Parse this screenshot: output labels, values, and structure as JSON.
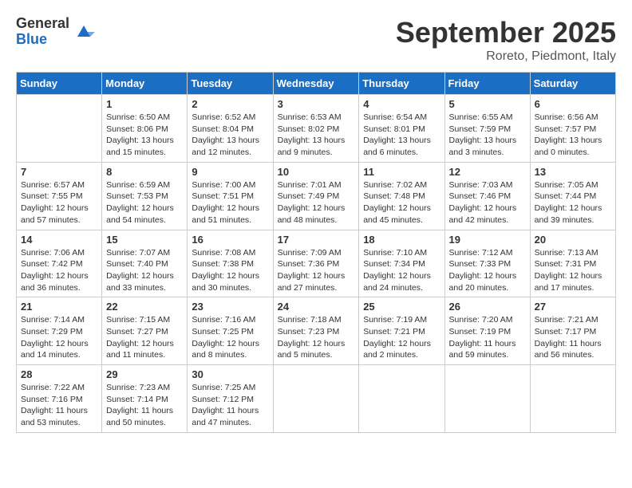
{
  "header": {
    "logo_general": "General",
    "logo_blue": "Blue",
    "title": "September 2025",
    "location": "Roreto, Piedmont, Italy"
  },
  "days_of_week": [
    "Sunday",
    "Monday",
    "Tuesday",
    "Wednesday",
    "Thursday",
    "Friday",
    "Saturday"
  ],
  "weeks": [
    [
      {
        "day": "",
        "info": ""
      },
      {
        "day": "1",
        "info": "Sunrise: 6:50 AM\nSunset: 8:06 PM\nDaylight: 13 hours\nand 15 minutes."
      },
      {
        "day": "2",
        "info": "Sunrise: 6:52 AM\nSunset: 8:04 PM\nDaylight: 13 hours\nand 12 minutes."
      },
      {
        "day": "3",
        "info": "Sunrise: 6:53 AM\nSunset: 8:02 PM\nDaylight: 13 hours\nand 9 minutes."
      },
      {
        "day": "4",
        "info": "Sunrise: 6:54 AM\nSunset: 8:01 PM\nDaylight: 13 hours\nand 6 minutes."
      },
      {
        "day": "5",
        "info": "Sunrise: 6:55 AM\nSunset: 7:59 PM\nDaylight: 13 hours\nand 3 minutes."
      },
      {
        "day": "6",
        "info": "Sunrise: 6:56 AM\nSunset: 7:57 PM\nDaylight: 13 hours\nand 0 minutes."
      }
    ],
    [
      {
        "day": "7",
        "info": "Sunrise: 6:57 AM\nSunset: 7:55 PM\nDaylight: 12 hours\nand 57 minutes."
      },
      {
        "day": "8",
        "info": "Sunrise: 6:59 AM\nSunset: 7:53 PM\nDaylight: 12 hours\nand 54 minutes."
      },
      {
        "day": "9",
        "info": "Sunrise: 7:00 AM\nSunset: 7:51 PM\nDaylight: 12 hours\nand 51 minutes."
      },
      {
        "day": "10",
        "info": "Sunrise: 7:01 AM\nSunset: 7:49 PM\nDaylight: 12 hours\nand 48 minutes."
      },
      {
        "day": "11",
        "info": "Sunrise: 7:02 AM\nSunset: 7:48 PM\nDaylight: 12 hours\nand 45 minutes."
      },
      {
        "day": "12",
        "info": "Sunrise: 7:03 AM\nSunset: 7:46 PM\nDaylight: 12 hours\nand 42 minutes."
      },
      {
        "day": "13",
        "info": "Sunrise: 7:05 AM\nSunset: 7:44 PM\nDaylight: 12 hours\nand 39 minutes."
      }
    ],
    [
      {
        "day": "14",
        "info": "Sunrise: 7:06 AM\nSunset: 7:42 PM\nDaylight: 12 hours\nand 36 minutes."
      },
      {
        "day": "15",
        "info": "Sunrise: 7:07 AM\nSunset: 7:40 PM\nDaylight: 12 hours\nand 33 minutes."
      },
      {
        "day": "16",
        "info": "Sunrise: 7:08 AM\nSunset: 7:38 PM\nDaylight: 12 hours\nand 30 minutes."
      },
      {
        "day": "17",
        "info": "Sunrise: 7:09 AM\nSunset: 7:36 PM\nDaylight: 12 hours\nand 27 minutes."
      },
      {
        "day": "18",
        "info": "Sunrise: 7:10 AM\nSunset: 7:34 PM\nDaylight: 12 hours\nand 24 minutes."
      },
      {
        "day": "19",
        "info": "Sunrise: 7:12 AM\nSunset: 7:33 PM\nDaylight: 12 hours\nand 20 minutes."
      },
      {
        "day": "20",
        "info": "Sunrise: 7:13 AM\nSunset: 7:31 PM\nDaylight: 12 hours\nand 17 minutes."
      }
    ],
    [
      {
        "day": "21",
        "info": "Sunrise: 7:14 AM\nSunset: 7:29 PM\nDaylight: 12 hours\nand 14 minutes."
      },
      {
        "day": "22",
        "info": "Sunrise: 7:15 AM\nSunset: 7:27 PM\nDaylight: 12 hours\nand 11 minutes."
      },
      {
        "day": "23",
        "info": "Sunrise: 7:16 AM\nSunset: 7:25 PM\nDaylight: 12 hours\nand 8 minutes."
      },
      {
        "day": "24",
        "info": "Sunrise: 7:18 AM\nSunset: 7:23 PM\nDaylight: 12 hours\nand 5 minutes."
      },
      {
        "day": "25",
        "info": "Sunrise: 7:19 AM\nSunset: 7:21 PM\nDaylight: 12 hours\nand 2 minutes."
      },
      {
        "day": "26",
        "info": "Sunrise: 7:20 AM\nSunset: 7:19 PM\nDaylight: 11 hours\nand 59 minutes."
      },
      {
        "day": "27",
        "info": "Sunrise: 7:21 AM\nSunset: 7:17 PM\nDaylight: 11 hours\nand 56 minutes."
      }
    ],
    [
      {
        "day": "28",
        "info": "Sunrise: 7:22 AM\nSunset: 7:16 PM\nDaylight: 11 hours\nand 53 minutes."
      },
      {
        "day": "29",
        "info": "Sunrise: 7:23 AM\nSunset: 7:14 PM\nDaylight: 11 hours\nand 50 minutes."
      },
      {
        "day": "30",
        "info": "Sunrise: 7:25 AM\nSunset: 7:12 PM\nDaylight: 11 hours\nand 47 minutes."
      },
      {
        "day": "",
        "info": ""
      },
      {
        "day": "",
        "info": ""
      },
      {
        "day": "",
        "info": ""
      },
      {
        "day": "",
        "info": ""
      }
    ]
  ]
}
